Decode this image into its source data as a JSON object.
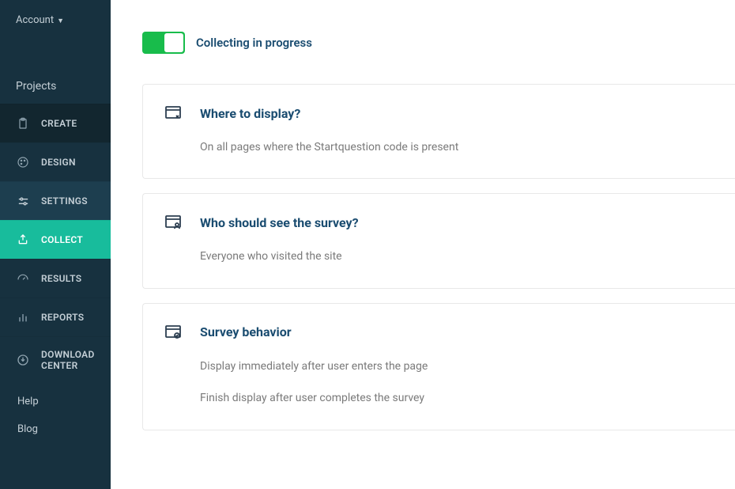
{
  "account": {
    "label": "Account"
  },
  "sidebar": {
    "projects": "Projects",
    "items": [
      {
        "label": "CREATE"
      },
      {
        "label": "DESIGN"
      },
      {
        "label": "SETTINGS"
      },
      {
        "label": "COLLECT"
      },
      {
        "label": "RESULTS"
      },
      {
        "label": "REPORTS"
      },
      {
        "label": "DOWNLOAD CENTER"
      }
    ],
    "footer": [
      {
        "label": "Help"
      },
      {
        "label": "Blog"
      }
    ]
  },
  "status": {
    "label": "Collecting in progress"
  },
  "cards": [
    {
      "title": "Where to display?",
      "lines": [
        "On all pages where the Startquestion code is present"
      ]
    },
    {
      "title": "Who should see the survey?",
      "lines": [
        "Everyone who visited the site"
      ]
    },
    {
      "title": "Survey behavior",
      "lines": [
        "Display immediately after user enters the page",
        "Finish display after user completes the survey"
      ]
    }
  ]
}
